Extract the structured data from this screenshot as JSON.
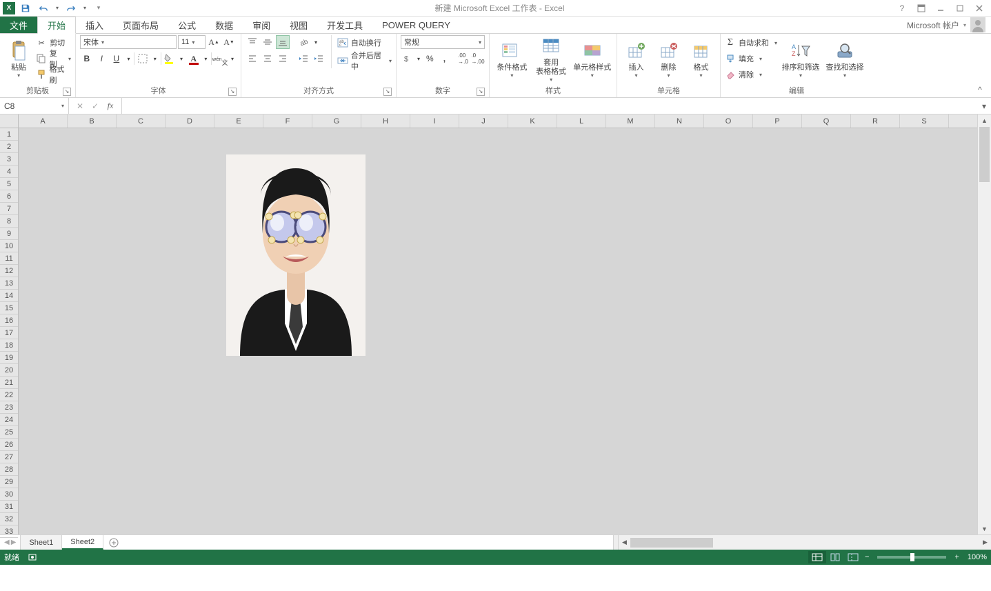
{
  "title": "新建 Microsoft Excel 工作表 - Excel",
  "account_label": "Microsoft 帐户",
  "tabs": {
    "file": "文件",
    "home": "开始",
    "insert": "插入",
    "layout": "页面布局",
    "formulas": "公式",
    "data": "数据",
    "review": "审阅",
    "view": "视图",
    "dev": "开发工具",
    "pq": "POWER QUERY"
  },
  "clipboard": {
    "paste": "粘贴",
    "cut": "剪切",
    "copy": "复制",
    "painter": "格式刷",
    "group": "剪贴板"
  },
  "font": {
    "name": "宋体",
    "size": "11",
    "group": "字体"
  },
  "align": {
    "wrap": "自动换行",
    "merge": "合并后居中",
    "group": "对齐方式"
  },
  "number": {
    "format": "常规",
    "group": "数字"
  },
  "styles": {
    "cond": "条件格式",
    "table": "套用\n表格格式",
    "cell": "单元格样式",
    "group": "样式"
  },
  "cells_grp": {
    "insert": "插入",
    "delete": "删除",
    "format": "格式",
    "group": "单元格"
  },
  "editing": {
    "sum": "自动求和",
    "fill": "填充",
    "clear": "清除",
    "sort": "排序和筛选",
    "find": "查找和选择",
    "group": "编辑"
  },
  "namebox": "C8",
  "formula": "",
  "columns": [
    "A",
    "B",
    "C",
    "D",
    "E",
    "F",
    "G",
    "H",
    "I",
    "J",
    "K",
    "L",
    "M",
    "N",
    "O",
    "P",
    "Q",
    "R",
    "S"
  ],
  "rows": [
    "1",
    "2",
    "3",
    "4",
    "5",
    "6",
    "7",
    "8",
    "9",
    "10",
    "11",
    "12",
    "13",
    "14",
    "15",
    "16",
    "17",
    "18",
    "19",
    "20",
    "21",
    "22",
    "23",
    "24",
    "25",
    "26",
    "27",
    "28",
    "29",
    "30",
    "31",
    "32",
    "33"
  ],
  "sheets": {
    "s1": "Sheet1",
    "s2": "Sheet2"
  },
  "status": {
    "ready": "就绪",
    "zoom": "100%"
  }
}
